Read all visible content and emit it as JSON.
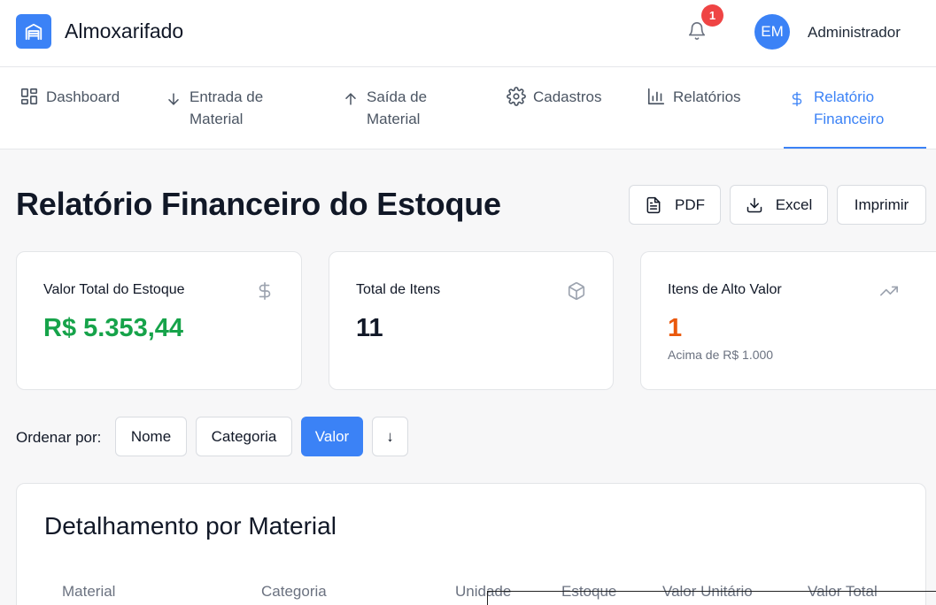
{
  "header": {
    "app_title": "Almoxarifado",
    "notification_count": "1",
    "avatar_initials": "EM",
    "user_name": "Administrador"
  },
  "nav": {
    "tabs": [
      {
        "label": "Dashboard",
        "icon": "grid-icon"
      },
      {
        "label": "Entrada de Material",
        "line1": "Entrada de",
        "line2": "Material",
        "icon": "arrow-down-icon"
      },
      {
        "label": "Saída de Material",
        "line1": "Saída de",
        "line2": "Material",
        "icon": "arrow-up-icon"
      },
      {
        "label": "Cadastros",
        "icon": "gear-icon"
      },
      {
        "label": "Relatórios",
        "icon": "bar-chart-icon"
      },
      {
        "label": "Relatório Financeiro",
        "line1": "Relatório",
        "line2": "Financeiro",
        "icon": "dollar-icon",
        "active": true
      }
    ]
  },
  "page": {
    "title": "Relatório Financeiro do Estoque",
    "actions": {
      "pdf": "PDF",
      "excel": "Excel",
      "print": "Imprimir"
    }
  },
  "cards": [
    {
      "label": "Valor Total do Estoque",
      "value": "R$ 5.353,44",
      "icon": "dollar-icon",
      "color": "#16a34a"
    },
    {
      "label": "Total de Itens",
      "value": "11",
      "icon": "box-icon",
      "color": "#111827"
    },
    {
      "label": "Itens de Alto Valor",
      "value": "1",
      "sub": "Acima de R$ 1.000",
      "icon": "trending-up-icon",
      "color": "#ea580c"
    }
  ],
  "sort": {
    "label": "Ordenar por:",
    "options": [
      "Nome",
      "Categoria",
      "Valor"
    ],
    "active": "Valor",
    "direction": "↓"
  },
  "detail": {
    "title": "Detalhamento por Material",
    "columns": [
      "Material",
      "Categoria",
      "Unidade",
      "Estoque",
      "Valor Unitário",
      "Valor Total"
    ]
  },
  "colors": {
    "accent": "#3b82f6",
    "badge": "#ef4444",
    "green": "#16a34a",
    "orange": "#ea580c"
  }
}
